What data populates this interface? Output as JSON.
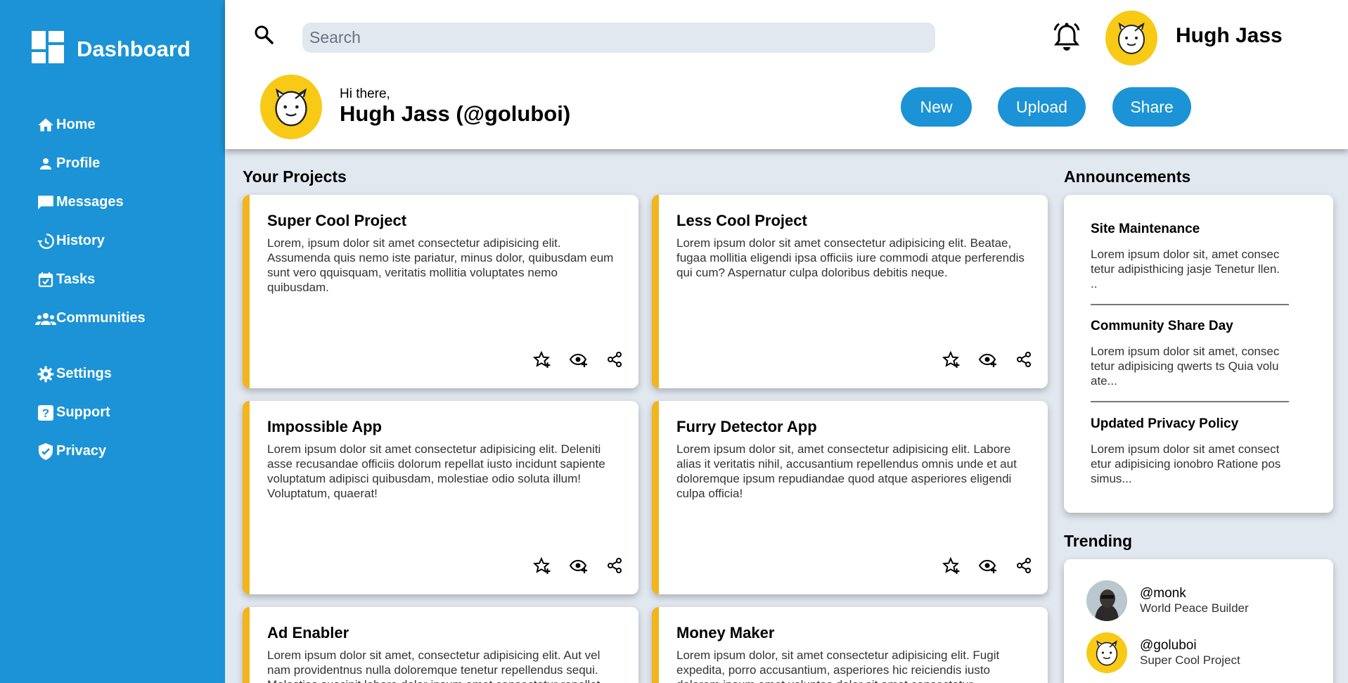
{
  "sidebar": {
    "brand": "Dashboard",
    "items": [
      {
        "label": "Home",
        "icon": "home-icon"
      },
      {
        "label": "Profile",
        "icon": "person-icon"
      },
      {
        "label": "Messages",
        "icon": "message-icon"
      },
      {
        "label": "History",
        "icon": "history-icon"
      },
      {
        "label": "Tasks",
        "icon": "calendar-check-icon"
      },
      {
        "label": "Communities",
        "icon": "group-icon"
      },
      {
        "label": "Settings",
        "icon": "gear-icon"
      },
      {
        "label": "Support",
        "icon": "help-icon"
      },
      {
        "label": "Privacy",
        "icon": "shield-check-icon"
      }
    ]
  },
  "header": {
    "search_placeholder": "Search",
    "username": "Hugh Jass",
    "greeting": "Hi there,",
    "full_name": "Hugh Jass (@goluboi)",
    "buttons": {
      "new": "New",
      "upload": "Upload",
      "share": "Share"
    }
  },
  "projects": {
    "title": "Your Projects",
    "items": [
      {
        "title": "Super Cool Project",
        "body": "Lorem, ipsum dolor sit amet consectetur adipisicing elit. Assumenda quis nemo iste pariatur, minus dolor, quibusdam eum sunt vero qquisquam, veritatis mollitia voluptates nemo quibusdam."
      },
      {
        "title": "Less Cool Project",
        "body": "Lorem ipsum dolor sit amet consectetur adipisicing elit. Beatae, fugaa mollitia eligendi ipsa officiis iure commodi atque perferendis qui cum? Aspernatur culpa doloribus debitis neque."
      },
      {
        "title": "Impossible App",
        "body": "Lorem ipsum dolor sit amet consectetur adipisicing elit. Deleniti asse recusandae officiis dolorum repellat iusto incidunt sapiente voluptatum adipisci quibusdam, molestiae odio soluta illum! Voluptatum, quaerat!"
      },
      {
        "title": "Furry Detector App",
        "body": "Lorem ipsum dolor sit, amet consectetur adipisicing elit. Labore alias it veritatis nihil, accusantium repellendus omnis unde et aut doloremque ipsum repudiandae quod atque asperiores eligendi culpa officia!"
      },
      {
        "title": "Ad Enabler",
        "body": "Lorem ipsum dolor sit amet, consectetur adipisicing elit. Aut vel nam providentnus nulla doloremque tenetur repellendus sequi. Molestias suscipit labore dolor ipsum amet consectetur repellat."
      },
      {
        "title": "Money Maker",
        "body": "Lorem ipsum dolor, sit amet consectetur adipisicing elit. Fugit expedita, porro accusantium, asperiores hic reiciendis iusto dolorem ipsum amet voluptas dolor sit amet consectetur."
      }
    ]
  },
  "announcements": {
    "title": "Announcements",
    "items": [
      {
        "title": "Site Maintenance",
        "body": "Lorem ipsum dolor sit, amet consec tetur adipisthicing jasje Tenetur llen. .."
      },
      {
        "title": "Community Share Day",
        "body": "Lorem ipsum dolor sit amet, consec tetur adipisicing qwerts ts Quia volu ate..."
      },
      {
        "title": "Updated Privacy Policy",
        "body": "Lorem ipsum dolor sit amet consect etur adipisicing ionobro Ratione pos simus..."
      }
    ]
  },
  "trending": {
    "title": "Trending",
    "items": [
      {
        "handle": "@monk",
        "desc": "World Peace Builder"
      },
      {
        "handle": "@goluboi",
        "desc": "Super Cool Project"
      }
    ]
  },
  "colors": {
    "primary": "#1b93d6",
    "accent": "#f2b51c",
    "avatar_bg": "#f8ca16",
    "background": "#e2e8f0"
  }
}
